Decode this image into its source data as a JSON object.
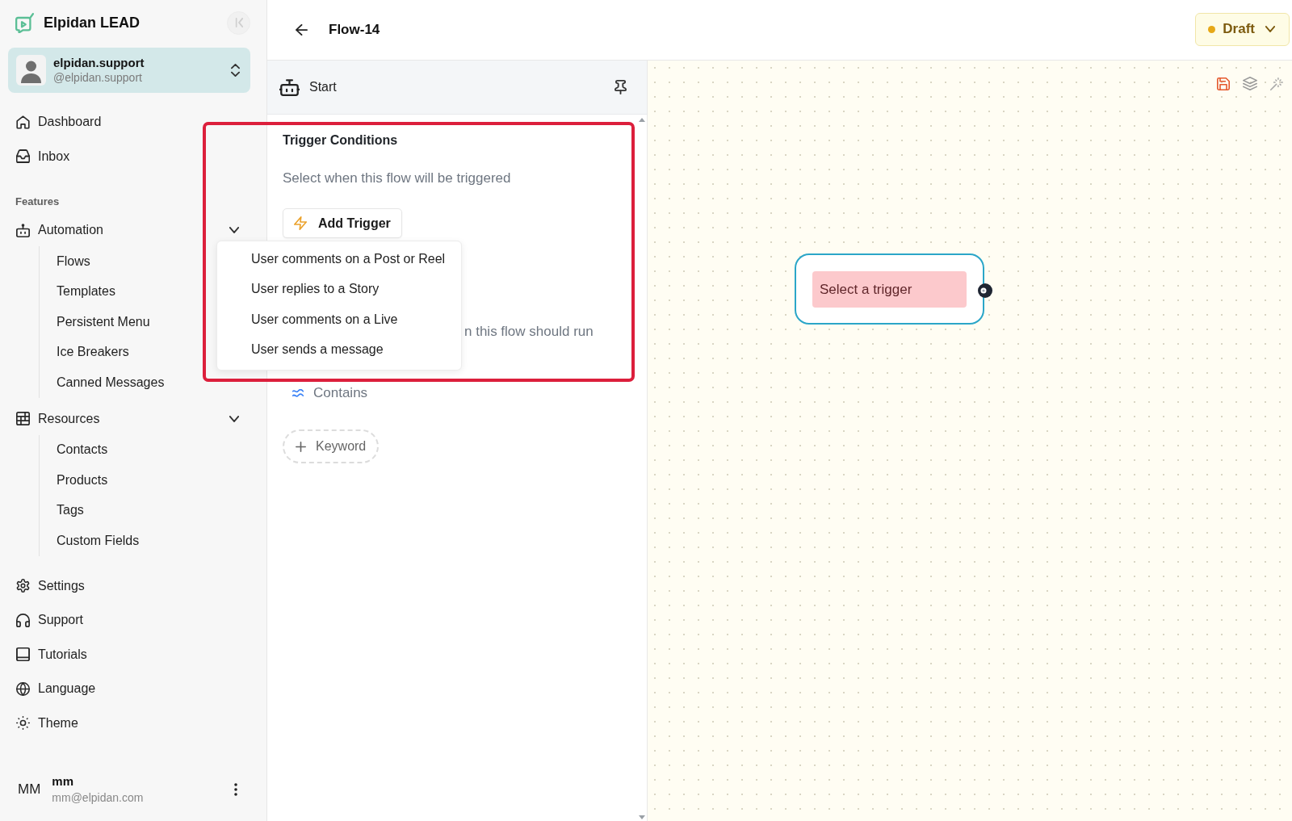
{
  "sidebar": {
    "brand": "Elpidan LEAD",
    "account": {
      "name": "elpidan.support",
      "handle": "@elpidan.support"
    },
    "nav": [
      {
        "label": "Dashboard"
      },
      {
        "label": "Inbox"
      }
    ],
    "section_label": "Features",
    "groups": [
      {
        "label": "Automation",
        "expanded": true,
        "children": [
          {
            "label": "Flows"
          },
          {
            "label": "Templates"
          },
          {
            "label": "Persistent Menu"
          },
          {
            "label": "Ice Breakers"
          },
          {
            "label": "Canned Messages"
          }
        ]
      },
      {
        "label": "Resources",
        "expanded": true,
        "children": [
          {
            "label": "Contacts"
          },
          {
            "label": "Products"
          },
          {
            "label": "Tags"
          },
          {
            "label": "Custom Fields"
          }
        ]
      }
    ],
    "footer_nav": [
      {
        "label": "Settings"
      },
      {
        "label": "Support"
      },
      {
        "label": "Tutorials"
      },
      {
        "label": "Language"
      },
      {
        "label": "Theme"
      }
    ],
    "user": {
      "initials": "MM",
      "name": "mm",
      "email": "mm@elpidan.com"
    }
  },
  "header": {
    "title": "Flow-14",
    "status": "Draft"
  },
  "panel": {
    "title": "Start",
    "section_title": "Trigger Conditions",
    "section_hint": "Select when this flow will be triggered",
    "add_button": "Add Trigger",
    "keyword_hint": "n this flow should run",
    "match_options": [
      {
        "label": "Contains"
      }
    ],
    "keyword_button": "Keyword"
  },
  "trigger_menu": [
    "User comments on a Post or Reel",
    "User replies to a Story",
    "User comments on a Live",
    "User sends a message"
  ],
  "canvas": {
    "node": {
      "label": "Select a trigger"
    }
  }
}
